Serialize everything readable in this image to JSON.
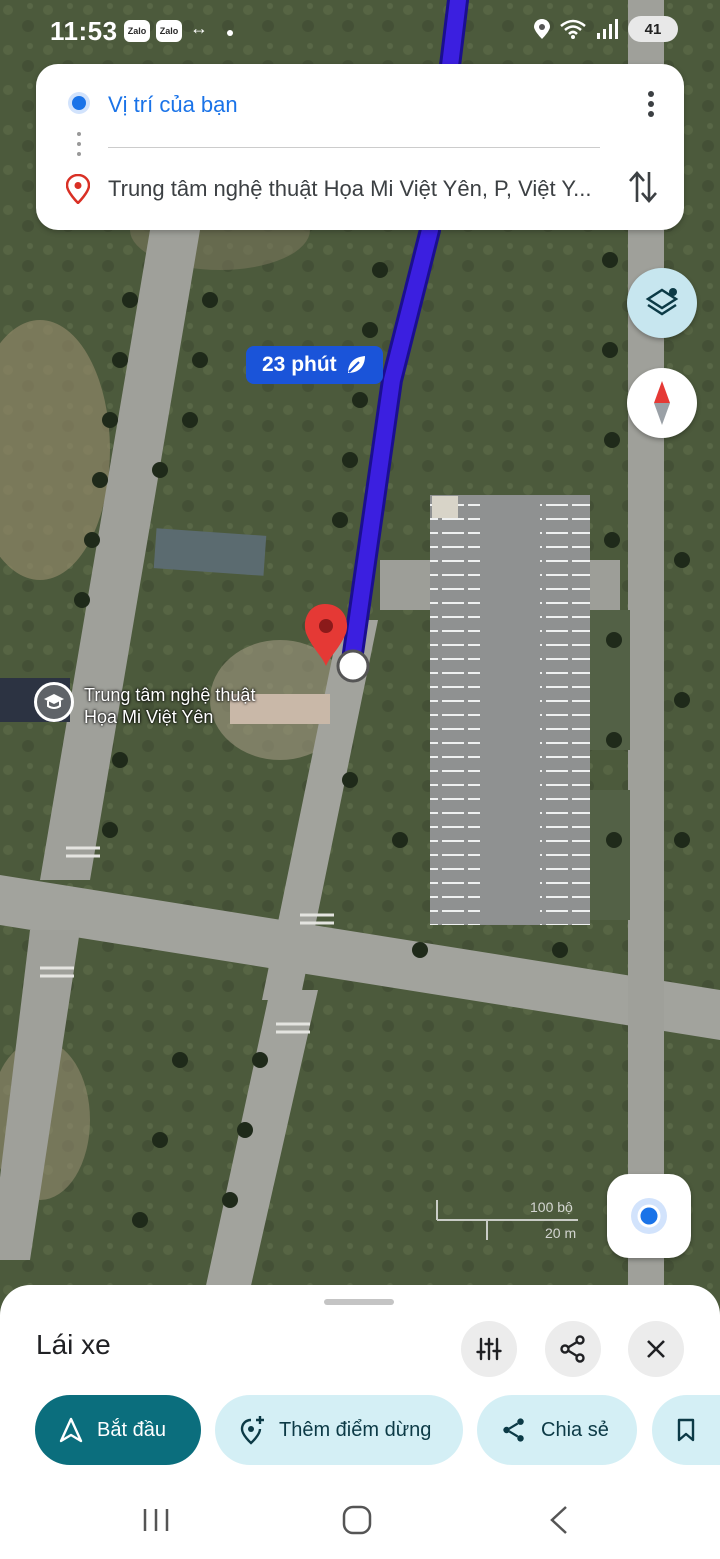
{
  "status_bar": {
    "time": "11:53",
    "notifications": [
      "Zalo",
      "Zalo"
    ],
    "extra_icon": "↔",
    "battery": "41"
  },
  "route": {
    "origin": "Vị trí của bạn",
    "destination": "Trung tâm nghệ thuật Họa Mi Việt Yên, P, Việt Y..."
  },
  "map": {
    "eta_label": "23 phút",
    "place_label_line1": "Trung tâm nghệ thuật",
    "place_label_line2": "Họa Mi Việt Yên",
    "scale_top": "100 bộ",
    "scale_bottom": "20 m",
    "route_color": "#3b1fe0"
  },
  "sheet": {
    "mode": "Lái xe",
    "chips": [
      {
        "label": "Bắt đầu",
        "icon": "navigation-arrow-icon"
      },
      {
        "label": "Thêm điểm dừng",
        "icon": "add-stop-icon"
      },
      {
        "label": "Chia sẻ",
        "icon": "share-icon"
      },
      {
        "label": "",
        "icon": "bookmark-icon"
      }
    ]
  },
  "colors": {
    "accent": "#1a73e8",
    "start_chip": "#0b6e7d",
    "secondary_chip": "#d4eff5",
    "eta_badge": "#1a54d9",
    "destination_pin": "#e53935"
  }
}
